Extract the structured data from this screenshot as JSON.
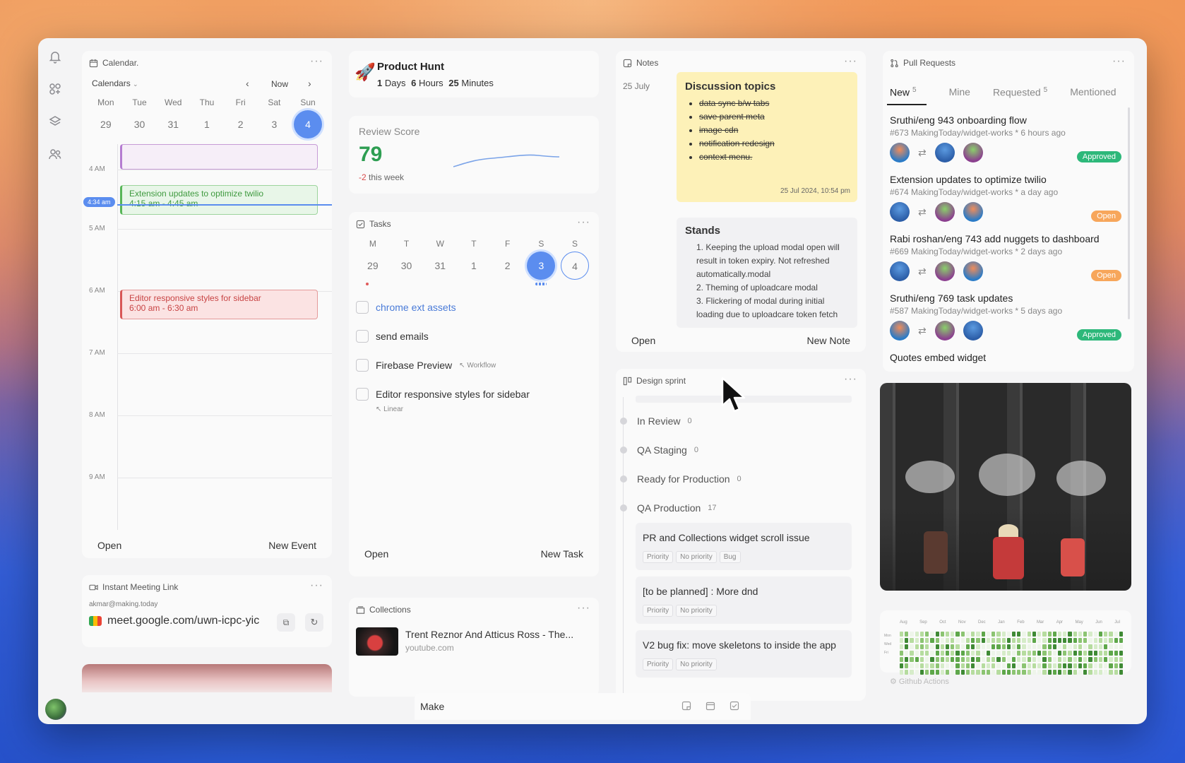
{
  "calendar": {
    "title": "Calendar.",
    "selector": "Calendars",
    "now": "Now",
    "days": [
      "Mon",
      "Tue",
      "Wed",
      "Thu",
      "Fri",
      "Sat",
      "Sun"
    ],
    "dates": [
      "29",
      "30",
      "31",
      "1",
      "2",
      "3",
      "4"
    ],
    "hours": [
      "4 AM",
      "5 AM",
      "6 AM",
      "7 AM",
      "8 AM",
      "9 AM"
    ],
    "now_time": "4:34 am",
    "events": [
      {
        "title": "Extension updates to optimize twilio",
        "time": "4:15 am - 4:45 am"
      },
      {
        "title": "Editor responsive styles for sidebar",
        "time": "6:00 am - 6:30 am"
      }
    ],
    "open": "Open",
    "new_event": "New Event"
  },
  "product_hunt": {
    "title": "Product Hunt",
    "days": "1",
    "days_label": "Days",
    "hours": "6",
    "hours_label": "Hours",
    "minutes": "25",
    "minutes_label": "Minutes"
  },
  "review_score": {
    "title": "Review Score",
    "value": "79",
    "delta": "-2",
    "delta_label": "this week"
  },
  "tasks": {
    "title": "Tasks",
    "days": [
      "M",
      "T",
      "W",
      "T",
      "F",
      "S",
      "S"
    ],
    "dates": [
      "29",
      "30",
      "31",
      "1",
      "2",
      "3",
      "4"
    ],
    "items": [
      {
        "label": "chrome ext assets",
        "tag": ""
      },
      {
        "label": "send emails",
        "tag": ""
      },
      {
        "label": "Firebase Preview",
        "tag": "Workflow"
      },
      {
        "label": "Editor responsive styles for sidebar",
        "tag": "Linear"
      }
    ],
    "open": "Open",
    "new_task": "New Task"
  },
  "meeting": {
    "title": "Instant Meeting Link",
    "email": "akmar@making.today",
    "link": "meet.google.com/uwn-icpc-yic"
  },
  "collections": {
    "title": "Collections",
    "item_title": "Trent Reznor And Atticus Ross - The...",
    "item_source": "youtube.com"
  },
  "notes": {
    "title": "Notes",
    "date": "25 July",
    "sticky_title": "Discussion topics",
    "sticky_items": [
      "data sync b/w tabs",
      "save parent meta",
      "image cdn",
      "notification redesign",
      "context menu."
    ],
    "sticky_stamp": "25 Jul 2024, 10:54 pm",
    "stands_title": "Stands",
    "stands_text": "1. Keeping the upload modal open will result in token expiry. Not refreshed automatically.modal\n2. Theming of uploadcare modal\n3. Flickering of modal during initial loading due to uploadcare token fetch",
    "open": "Open",
    "new_note": "New Note"
  },
  "design_sprint": {
    "title": "Design sprint",
    "stages": [
      {
        "name": "In Review",
        "count": "0"
      },
      {
        "name": "QA Staging",
        "count": "0"
      },
      {
        "name": "Ready for Production",
        "count": "0"
      },
      {
        "name": "QA Production",
        "count": "17"
      }
    ],
    "cards": [
      {
        "title": "PR and Collections widget scroll issue",
        "p1": "Priority",
        "p2": "No priority",
        "p3": "Bug"
      },
      {
        "title": "[to be planned] : More dnd",
        "p1": "Priority",
        "p2": "No priority",
        "p3": ""
      },
      {
        "title": "V2 bug fix: move skeletons to inside the app",
        "p1": "Priority",
        "p2": "No priority",
        "p3": ""
      }
    ]
  },
  "pull_requests": {
    "title": "Pull Requests",
    "tabs": [
      {
        "label": "New",
        "count": "5"
      },
      {
        "label": "Mine",
        "count": ""
      },
      {
        "label": "Requested",
        "count": "5"
      },
      {
        "label": "Mentioned",
        "count": ""
      }
    ],
    "items": [
      {
        "title": "Sruthi/eng 943 onboarding flow",
        "meta": "#673 MakingToday/widget-works * 6 hours ago",
        "status": "Approved"
      },
      {
        "title": "Extension updates to optimize twilio",
        "meta": "#674 MakingToday/widget-works * a day ago",
        "status": "Open"
      },
      {
        "title": "Rabi roshan/eng 743 add nuggets to dashboard",
        "meta": "#669 MakingToday/widget-works * 2 days ago",
        "status": "Open"
      },
      {
        "title": "Sruthi/eng 769 task updates",
        "meta": "#587 MakingToday/widget-works * 5 days ago",
        "status": "Approved"
      },
      {
        "title": "Quotes embed widget",
        "meta": "",
        "status": ""
      }
    ]
  },
  "heatmap": {
    "months": [
      "Aug",
      "Sep",
      "Oct",
      "Nov",
      "Dec",
      "Jan",
      "Feb",
      "Mar",
      "Apr",
      "May",
      "Jun",
      "Jul"
    ],
    "rows": [
      "Mon",
      "Wed",
      "Fri"
    ]
  },
  "github_actions": "Github Actions",
  "bottom_bar": {
    "label": "Make"
  },
  "colors": {
    "accent": "#5b8def",
    "green": "#2db87a",
    "red": "#e05a5a"
  }
}
